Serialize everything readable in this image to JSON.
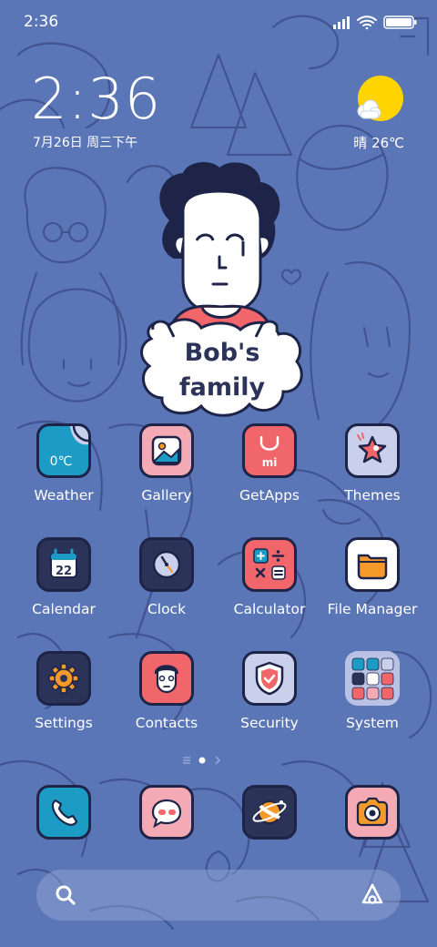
{
  "status_bar": {
    "time": "2:36",
    "signal": "signal-icon",
    "wifi": "wifi-icon",
    "battery": "battery-icon"
  },
  "clock_widget": {
    "time": "2:36",
    "date": "7月26日 周三下午"
  },
  "weather_widget": {
    "text": "晴 26℃",
    "icon": "sunny-cloud-icon"
  },
  "family_widget": {
    "line1": "Bob's",
    "line2": "family"
  },
  "apps": [
    {
      "label": "Weather",
      "icon": "weather-icon",
      "icon_text": "0℃"
    },
    {
      "label": "Gallery",
      "icon": "gallery-icon"
    },
    {
      "label": "GetApps",
      "icon": "getapps-icon",
      "icon_text": "mi"
    },
    {
      "label": "Themes",
      "icon": "themes-icon"
    },
    {
      "label": "Calendar",
      "icon": "calendar-icon",
      "icon_text": "22"
    },
    {
      "label": "Clock",
      "icon": "clock-icon"
    },
    {
      "label": "Calculator",
      "icon": "calculator-icon"
    },
    {
      "label": "File Manager",
      "icon": "folder-icon"
    },
    {
      "label": "Settings",
      "icon": "gear-icon"
    },
    {
      "label": "Contacts",
      "icon": "contacts-icon"
    },
    {
      "label": "Security",
      "icon": "shield-icon"
    },
    {
      "label": "System",
      "icon": "folder-grid-icon"
    }
  ],
  "page_indicator": {
    "pages": 2,
    "current": 1
  },
  "dock": [
    {
      "icon": "phone-icon"
    },
    {
      "icon": "messages-icon"
    },
    {
      "icon": "browser-icon"
    },
    {
      "icon": "camera-icon"
    }
  ],
  "search_bar": {
    "left_icon": "search-icon",
    "right_icon": "assistant-icon"
  },
  "colors": {
    "wallpaper": "#5b76b6",
    "icon_outline": "#1e2448",
    "teal": "#1c9bc4",
    "pink": "#f4aab4",
    "coral": "#f0666a",
    "lavender": "#c9d0ec",
    "navy": "#2c3358",
    "white": "#ffffff",
    "orange": "#f59a2a",
    "sun": "#ffd400"
  }
}
